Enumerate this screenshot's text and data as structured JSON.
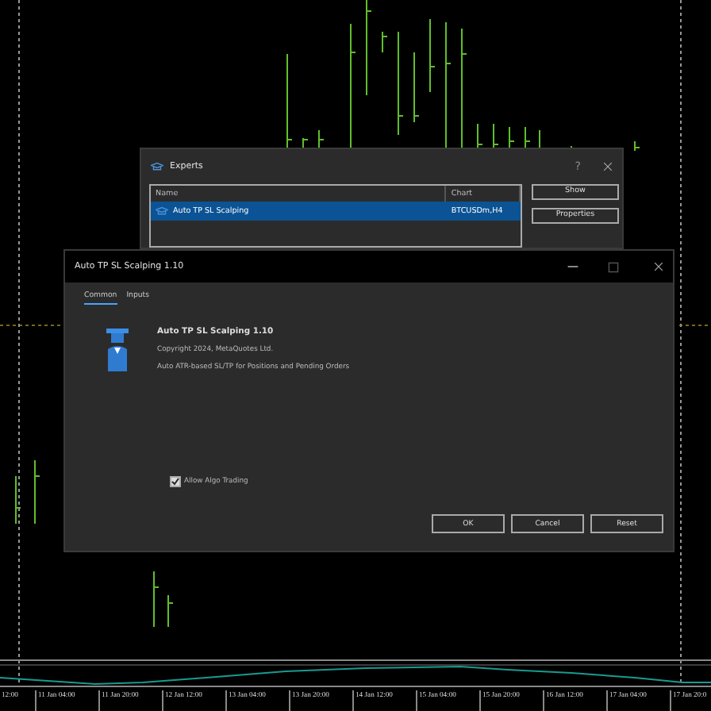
{
  "experts_window": {
    "title": "Experts",
    "help": "?",
    "columns": [
      "Name",
      "Chart"
    ],
    "rows": [
      {
        "name": "Auto TP SL Scalping",
        "chart": "BTCUSDm,H4",
        "selected": true
      }
    ],
    "buttons": [
      "Show",
      "Properties"
    ]
  },
  "properties_window": {
    "title": "Auto TP SL Scalping 1.10",
    "tabs": [
      {
        "label": "Common",
        "selected": true
      },
      {
        "label": "Inputs",
        "selected": false
      }
    ],
    "program": {
      "name": "Auto TP SL Scalping 1.10",
      "copyright": "Copyright 2024, MetaQuotes Ltd.",
      "description": "Auto ATR-based SL/TP for Positions and Pending Orders"
    },
    "allow_algo_trading": {
      "label": "Allow Algo Trading",
      "checked": true
    },
    "buttons": [
      "OK",
      "Cancel",
      "Reset"
    ]
  },
  "time_axis": [
    "12:00",
    "11 Jan 04:00",
    "11 Jan 20:00",
    "12 Jan 12:00",
    "13 Jan 04:00",
    "13 Jan 20:00",
    "14 Jan 12:00",
    "15 Jan 04:00",
    "15 Jan 20:00",
    "16 Jan 12:00",
    "17 Jan 04:00",
    "17 Jan 20:0"
  ]
}
